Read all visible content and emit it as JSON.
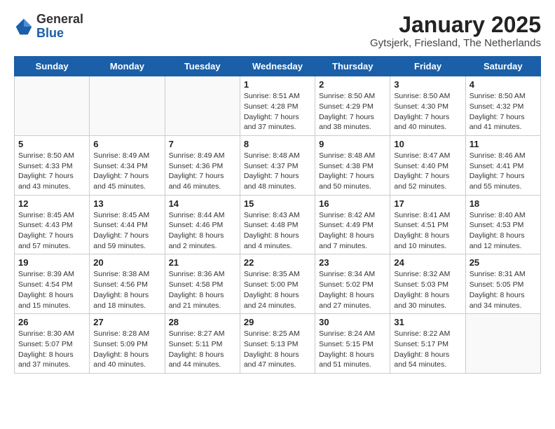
{
  "logo": {
    "general": "General",
    "blue": "Blue"
  },
  "title": "January 2025",
  "location": "Gytsjerk, Friesland, The Netherlands",
  "days_header": [
    "Sunday",
    "Monday",
    "Tuesday",
    "Wednesday",
    "Thursday",
    "Friday",
    "Saturday"
  ],
  "weeks": [
    [
      {
        "day": "",
        "detail": ""
      },
      {
        "day": "",
        "detail": ""
      },
      {
        "day": "",
        "detail": ""
      },
      {
        "day": "1",
        "detail": "Sunrise: 8:51 AM\nSunset: 4:28 PM\nDaylight: 7 hours\nand 37 minutes."
      },
      {
        "day": "2",
        "detail": "Sunrise: 8:50 AM\nSunset: 4:29 PM\nDaylight: 7 hours\nand 38 minutes."
      },
      {
        "day": "3",
        "detail": "Sunrise: 8:50 AM\nSunset: 4:30 PM\nDaylight: 7 hours\nand 40 minutes."
      },
      {
        "day": "4",
        "detail": "Sunrise: 8:50 AM\nSunset: 4:32 PM\nDaylight: 7 hours\nand 41 minutes."
      }
    ],
    [
      {
        "day": "5",
        "detail": "Sunrise: 8:50 AM\nSunset: 4:33 PM\nDaylight: 7 hours\nand 43 minutes."
      },
      {
        "day": "6",
        "detail": "Sunrise: 8:49 AM\nSunset: 4:34 PM\nDaylight: 7 hours\nand 45 minutes."
      },
      {
        "day": "7",
        "detail": "Sunrise: 8:49 AM\nSunset: 4:36 PM\nDaylight: 7 hours\nand 46 minutes."
      },
      {
        "day": "8",
        "detail": "Sunrise: 8:48 AM\nSunset: 4:37 PM\nDaylight: 7 hours\nand 48 minutes."
      },
      {
        "day": "9",
        "detail": "Sunrise: 8:48 AM\nSunset: 4:38 PM\nDaylight: 7 hours\nand 50 minutes."
      },
      {
        "day": "10",
        "detail": "Sunrise: 8:47 AM\nSunset: 4:40 PM\nDaylight: 7 hours\nand 52 minutes."
      },
      {
        "day": "11",
        "detail": "Sunrise: 8:46 AM\nSunset: 4:41 PM\nDaylight: 7 hours\nand 55 minutes."
      }
    ],
    [
      {
        "day": "12",
        "detail": "Sunrise: 8:45 AM\nSunset: 4:43 PM\nDaylight: 7 hours\nand 57 minutes."
      },
      {
        "day": "13",
        "detail": "Sunrise: 8:45 AM\nSunset: 4:44 PM\nDaylight: 7 hours\nand 59 minutes."
      },
      {
        "day": "14",
        "detail": "Sunrise: 8:44 AM\nSunset: 4:46 PM\nDaylight: 8 hours\nand 2 minutes."
      },
      {
        "day": "15",
        "detail": "Sunrise: 8:43 AM\nSunset: 4:48 PM\nDaylight: 8 hours\nand 4 minutes."
      },
      {
        "day": "16",
        "detail": "Sunrise: 8:42 AM\nSunset: 4:49 PM\nDaylight: 8 hours\nand 7 minutes."
      },
      {
        "day": "17",
        "detail": "Sunrise: 8:41 AM\nSunset: 4:51 PM\nDaylight: 8 hours\nand 10 minutes."
      },
      {
        "day": "18",
        "detail": "Sunrise: 8:40 AM\nSunset: 4:53 PM\nDaylight: 8 hours\nand 12 minutes."
      }
    ],
    [
      {
        "day": "19",
        "detail": "Sunrise: 8:39 AM\nSunset: 4:54 PM\nDaylight: 8 hours\nand 15 minutes."
      },
      {
        "day": "20",
        "detail": "Sunrise: 8:38 AM\nSunset: 4:56 PM\nDaylight: 8 hours\nand 18 minutes."
      },
      {
        "day": "21",
        "detail": "Sunrise: 8:36 AM\nSunset: 4:58 PM\nDaylight: 8 hours\nand 21 minutes."
      },
      {
        "day": "22",
        "detail": "Sunrise: 8:35 AM\nSunset: 5:00 PM\nDaylight: 8 hours\nand 24 minutes."
      },
      {
        "day": "23",
        "detail": "Sunrise: 8:34 AM\nSunset: 5:02 PM\nDaylight: 8 hours\nand 27 minutes."
      },
      {
        "day": "24",
        "detail": "Sunrise: 8:32 AM\nSunset: 5:03 PM\nDaylight: 8 hours\nand 30 minutes."
      },
      {
        "day": "25",
        "detail": "Sunrise: 8:31 AM\nSunset: 5:05 PM\nDaylight: 8 hours\nand 34 minutes."
      }
    ],
    [
      {
        "day": "26",
        "detail": "Sunrise: 8:30 AM\nSunset: 5:07 PM\nDaylight: 8 hours\nand 37 minutes."
      },
      {
        "day": "27",
        "detail": "Sunrise: 8:28 AM\nSunset: 5:09 PM\nDaylight: 8 hours\nand 40 minutes."
      },
      {
        "day": "28",
        "detail": "Sunrise: 8:27 AM\nSunset: 5:11 PM\nDaylight: 8 hours\nand 44 minutes."
      },
      {
        "day": "29",
        "detail": "Sunrise: 8:25 AM\nSunset: 5:13 PM\nDaylight: 8 hours\nand 47 minutes."
      },
      {
        "day": "30",
        "detail": "Sunrise: 8:24 AM\nSunset: 5:15 PM\nDaylight: 8 hours\nand 51 minutes."
      },
      {
        "day": "31",
        "detail": "Sunrise: 8:22 AM\nSunset: 5:17 PM\nDaylight: 8 hours\nand 54 minutes."
      },
      {
        "day": "",
        "detail": ""
      }
    ]
  ]
}
